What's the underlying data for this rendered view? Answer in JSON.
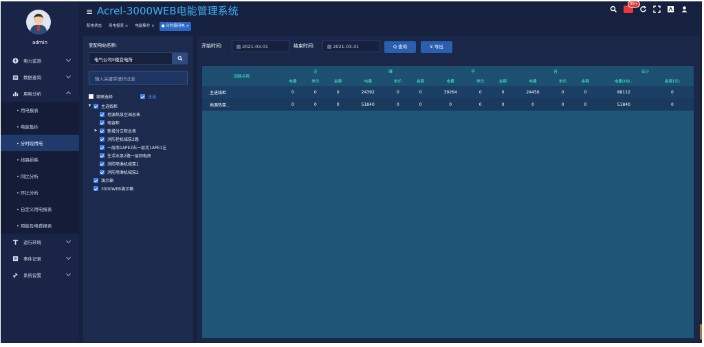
{
  "app": {
    "title": "Acrel-3000WEB电能管理系统",
    "hamburger": "≡",
    "badge": "99+"
  },
  "header_icons": [
    "search-icon",
    "bell-icon",
    "refresh-icon",
    "fullscreen-icon",
    "translate-icon",
    "user-icon"
  ],
  "tabs": [
    {
      "label": "配电状态"
    },
    {
      "label": "用电报表 ×"
    },
    {
      "label": "电能集抄 ×"
    },
    {
      "label": "● 分时段用电 ×"
    }
  ],
  "sidebar": {
    "username": "admin",
    "menu": [
      {
        "label": "电力监测",
        "icon": "lightning-icon"
      },
      {
        "label": "数据查询",
        "icon": "database-icon"
      },
      {
        "label": "用电分析",
        "icon": "chart-icon"
      }
    ],
    "submenu": [
      {
        "label": "• 用电报表"
      },
      {
        "label": "• 电能集抄"
      },
      {
        "label": "• 分时段用电"
      },
      {
        "label": "• 线路损耗"
      },
      {
        "label": "• 同比分析"
      },
      {
        "label": "• 环比分析"
      },
      {
        "label": "• 自定义用电报表"
      },
      {
        "label": "• 用能及电费报表"
      }
    ],
    "menu_bottom": [
      {
        "label": "运行环境",
        "icon": "env-icon"
      },
      {
        "label": "事件记录",
        "icon": "event-icon"
      },
      {
        "label": "系统设置",
        "icon": "settings-icon"
      }
    ]
  },
  "tree_panel": {
    "label": "变配电站名称:",
    "station": "电气公司II楼变电所",
    "filter_placeholder": "输入关键字进行过滤",
    "cascade_label": "级联选择",
    "all_label": "全选",
    "nodes": [
      {
        "label": "主进线柜",
        "level": 0,
        "arrow": "▼"
      },
      {
        "label": "地源热泵空调总表",
        "level": 1,
        "arrow": ""
      },
      {
        "label": "电容柜",
        "level": 1,
        "arrow": ""
      },
      {
        "label": "新增分立柜总表",
        "level": 1,
        "arrow": "▶"
      },
      {
        "label": "消防栓机械泵2路",
        "level": 1,
        "arrow": ""
      },
      {
        "label": "一层南1APE2右一层北1APE1左",
        "level": 1,
        "arrow": ""
      },
      {
        "label": "生活水泵2路一层回电房",
        "level": 1,
        "arrow": ""
      },
      {
        "label": "消防喷淋机械泵1",
        "level": 1,
        "arrow": ""
      },
      {
        "label": "消防喷淋机械泵2",
        "level": 1,
        "arrow": ""
      },
      {
        "label": "演示箱",
        "level": 0,
        "arrow": ""
      },
      {
        "label": "3000WEB演示箱",
        "level": 0,
        "arrow": ""
      }
    ]
  },
  "query": {
    "start_label": "开始时间:",
    "start_date": "2021-03-01",
    "end_label": "结束时间:",
    "end_date": "2021-03-31",
    "query_button": "Q 查询",
    "export_button": "⊻ 导出"
  },
  "table": {
    "name_header": "回路名称",
    "groups": [
      "尖",
      "峰",
      "平",
      "谷",
      "合计"
    ],
    "sub_headers": [
      "电量",
      "单价",
      "金额",
      "电量",
      "单价",
      "金额",
      "电量",
      "单价",
      "金额",
      "电量",
      "单价",
      "金额",
      "电量(kW...",
      "金额(元)"
    ],
    "rows": [
      {
        "name": "主进线柜",
        "cells": [
          "0",
          "0",
          "0",
          "24392",
          "0",
          "0",
          "39264",
          "0",
          "0",
          "24456",
          "0",
          "0",
          "88112",
          "0"
        ]
      },
      {
        "name": "地源热泵...",
        "cells": [
          "0",
          "0",
          "0",
          "51840",
          "0",
          "0",
          "0",
          "0",
          "0",
          "0",
          "0",
          "0",
          "51840",
          "0"
        ]
      }
    ]
  }
}
